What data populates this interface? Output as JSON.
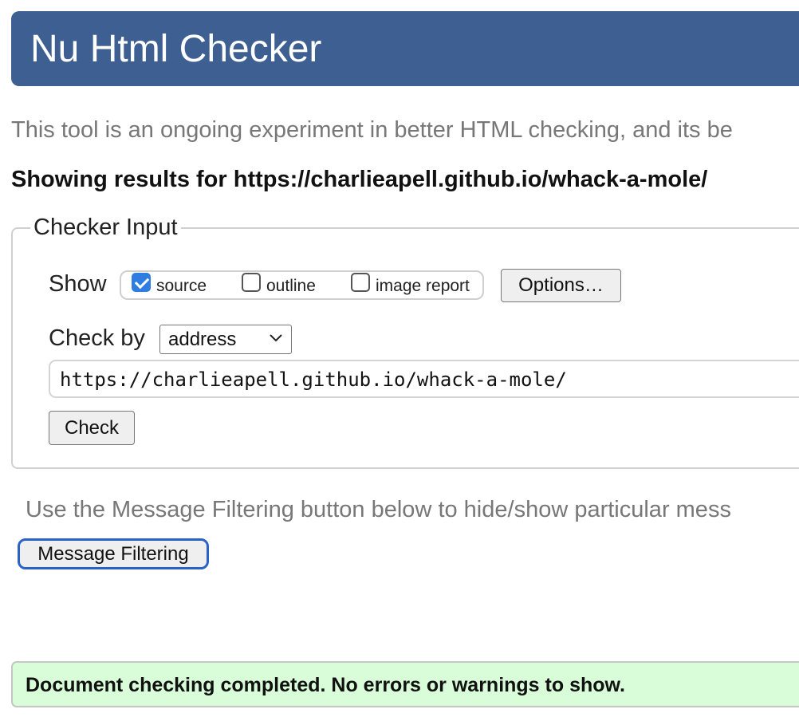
{
  "header": {
    "title": "Nu Html Checker"
  },
  "intro_text": "This tool is an ongoing experiment in better HTML checking, and its be",
  "results_heading": "Showing results for https://charlieapell.github.io/whack-a-mole/",
  "checker_input": {
    "legend": "Checker Input",
    "show_label": "Show",
    "show_options": [
      {
        "label": "source",
        "checked": true
      },
      {
        "label": "outline",
        "checked": false
      },
      {
        "label": "image report",
        "checked": false
      }
    ],
    "options_button": "Options…",
    "check_by_label": "Check by",
    "check_by_value": "address",
    "url_value": "https://charlieapell.github.io/whack-a-mole/",
    "check_button": "Check"
  },
  "filter_info": "Use the Message Filtering button below to hide/show particular mess",
  "filter_button": "Message Filtering",
  "status_message": "Document checking completed. No errors or warnings to show.",
  "colors": {
    "header_bg": "#3d5f92",
    "status_bg": "#d8fdd8",
    "checkbox_checked": "#2f7de1",
    "focus_ring": "#2a62c9"
  },
  "icons": {
    "select_arrow": "chevron-down-icon",
    "checkmark": "check-icon"
  }
}
